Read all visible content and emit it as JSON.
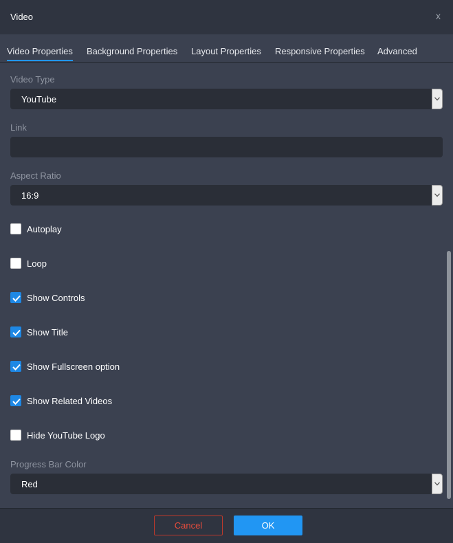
{
  "dialog": {
    "title": "Video",
    "close_label": "x"
  },
  "tabs": [
    {
      "label": "Video Properties",
      "active": true
    },
    {
      "label": "Background Properties",
      "active": false
    },
    {
      "label": "Layout Properties",
      "active": false
    },
    {
      "label": "Responsive Properties",
      "active": false
    },
    {
      "label": "Advanced",
      "active": false
    }
  ],
  "fields": {
    "video_type": {
      "label": "Video Type",
      "value": "YouTube"
    },
    "link": {
      "label": "Link",
      "value": ""
    },
    "aspect_ratio": {
      "label": "Aspect Ratio",
      "value": "16:9"
    },
    "progress_bar_color": {
      "label": "Progress Bar Color",
      "value": "Red"
    }
  },
  "options": [
    {
      "label": "Autoplay",
      "checked": false
    },
    {
      "label": "Loop",
      "checked": false
    },
    {
      "label": "Show Controls",
      "checked": true
    },
    {
      "label": "Show Title",
      "checked": true
    },
    {
      "label": "Show Fullscreen option",
      "checked": true
    },
    {
      "label": "Show Related Videos",
      "checked": true
    },
    {
      "label": "Hide YouTube Logo",
      "checked": false
    }
  ],
  "footer": {
    "cancel_label": "Cancel",
    "ok_label": "OK"
  },
  "colors": {
    "accent": "#2196f3",
    "cancel": "#e74c3c",
    "background": "#3b4150"
  }
}
